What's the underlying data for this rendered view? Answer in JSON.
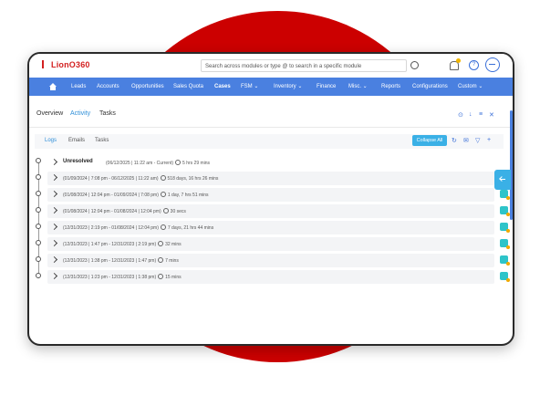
{
  "app": {
    "logo": "LionO360"
  },
  "search": {
    "placeholder": "Search across modules or type @ to search in a specific module"
  },
  "nav": {
    "items": [
      {
        "label": "Leads"
      },
      {
        "label": "Accounts"
      },
      {
        "label": "Opportunities"
      },
      {
        "label": "Sales Quota"
      },
      {
        "label": "Cases"
      },
      {
        "label": "FSM ⌄"
      },
      {
        "label": "Inventory ⌄"
      },
      {
        "label": "Finance"
      },
      {
        "label": "Misc. ⌄"
      },
      {
        "label": "Reports"
      },
      {
        "label": "Configurations"
      },
      {
        "label": "Custom ⌄"
      }
    ],
    "active": "Cases"
  },
  "tabs": [
    {
      "label": "Overview"
    },
    {
      "label": "Activity"
    },
    {
      "label": "Tasks"
    }
  ],
  "subtabs": [
    {
      "label": "Logs"
    },
    {
      "label": "Emails"
    },
    {
      "label": "Tasks"
    }
  ],
  "actions": {
    "collapse_all": "Collapse All"
  },
  "timeline": {
    "unresolved": {
      "label": "Unresolved",
      "range": "(06/12/2025 | 11:22 am - Current)",
      "duration": "5 hrs 29 mins"
    },
    "rows": [
      {
        "range": "(01/09/2024 | 7:08 pm - 06/12/2025 | 11:22 am)",
        "duration": "518 days, 16 hrs 26 mins"
      },
      {
        "range": "(01/08/2024 | 12:04 pm - 01/09/2024 | 7:08 pm)",
        "duration": "1 day, 7 hrs 51 mins"
      },
      {
        "range": "(01/08/2024 | 12:04 pm - 01/08/2024 | 12:04 pm)",
        "duration": "30 secs"
      },
      {
        "range": "(12/31/2023 | 2:19 pm - 01/08/2024 | 12:04 pm)",
        "duration": "7 days, 21 hrs 44 mins"
      },
      {
        "range": "(12/31/2023 | 1:47 pm - 12/31/2023 | 2:19 pm)",
        "duration": "32 mins"
      },
      {
        "range": "(12/31/2023 | 1:38 pm - 12/31/2023 | 1:47 pm)",
        "duration": "7 mins"
      },
      {
        "range": "(12/31/2023 | 1:23 pm - 12/31/2023 | 1:38 pm)",
        "duration": "15 mins"
      }
    ]
  },
  "colors": {
    "accent": "#4a80e0",
    "brand_red": "#cc0000",
    "button": "#3ab0e6",
    "action_icon": "#2ec4c9"
  }
}
